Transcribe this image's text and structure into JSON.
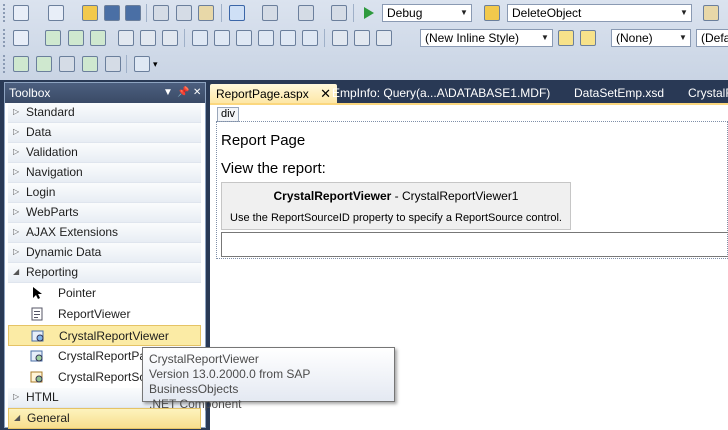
{
  "toolbar": {
    "configuration": "Debug",
    "find_value": "DeleteObject",
    "style_value": "(New Inline Style)",
    "rule_value": "(None)",
    "target_value": "(Defa"
  },
  "toolbox": {
    "title": "Toolbox",
    "categories": [
      {
        "label": "Standard"
      },
      {
        "label": "Data"
      },
      {
        "label": "Validation"
      },
      {
        "label": "Navigation"
      },
      {
        "label": "Login"
      },
      {
        "label": "WebParts"
      },
      {
        "label": "AJAX Extensions"
      },
      {
        "label": "Dynamic Data"
      },
      {
        "label": "Reporting"
      }
    ],
    "reporting_items": [
      {
        "label": "Pointer",
        "icon": "pointer-icon"
      },
      {
        "label": "ReportViewer",
        "icon": "report-viewer-icon"
      },
      {
        "label": "CrystalReportViewer",
        "icon": "crystal-report-viewer-icon"
      },
      {
        "label": "CrystalReportPartsV",
        "icon": "crystal-report-parts-icon"
      },
      {
        "label": "CrystalReportSo",
        "icon": "crystal-report-source-icon"
      }
    ],
    "bottom_categories": [
      {
        "label": "HTML"
      },
      {
        "label": "General"
      }
    ]
  },
  "tooltip": {
    "line1": "CrystalReportViewer",
    "line2": "Version 13.0.2000.0 from SAP BusinessObjects",
    "line3": ".NET Component"
  },
  "tabs": [
    {
      "label": "ReportPage.aspx"
    },
    {
      "label": "EmpInfo: Query(a...A\\DATABASE1.MDF)"
    },
    {
      "label": "DataSetEmp.xsd"
    },
    {
      "label": "CrystalR"
    }
  ],
  "design": {
    "div_tag": "div",
    "heading": "Report Page",
    "paragraph": "View the report:",
    "crv_name": "CrystalReportViewer",
    "crv_id": " - CrystalReportViewer1",
    "crv_desc": "Use the ReportSourceID property to specify a ReportSource control."
  },
  "colors": {
    "ide_background": "#293955",
    "selection": "#fbeba5",
    "active_tab": "#fde7a6"
  }
}
